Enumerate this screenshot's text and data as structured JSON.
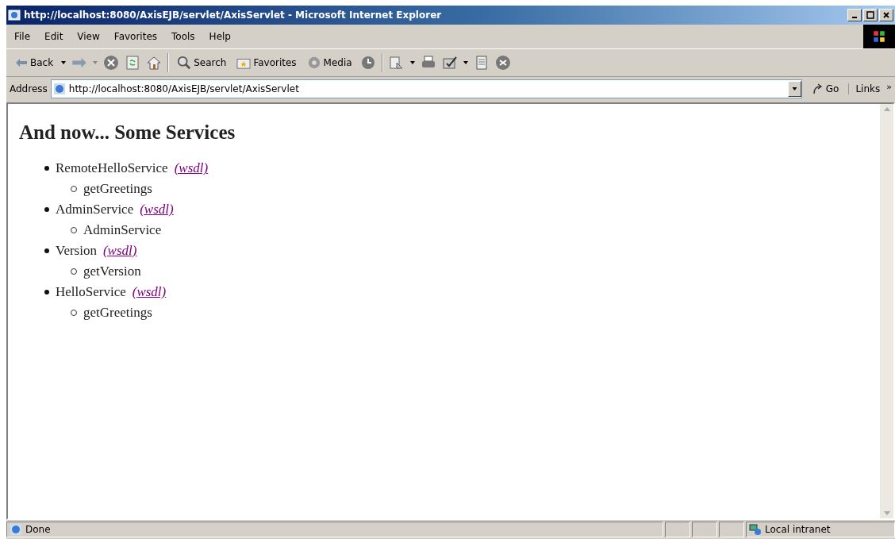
{
  "window": {
    "title": "http://localhost:8080/AxisEJB/servlet/AxisServlet - Microsoft Internet Explorer"
  },
  "menu": [
    "File",
    "Edit",
    "View",
    "Favorites",
    "Tools",
    "Help"
  ],
  "toolbar": {
    "back": "Back",
    "search": "Search",
    "favorites": "Favorites",
    "media": "Media"
  },
  "address_bar": {
    "label": "Address",
    "value": "http://localhost:8080/AxisEJB/servlet/AxisServlet",
    "go": "Go",
    "links": "Links",
    "more": "»"
  },
  "page": {
    "heading": "And now... Some Services",
    "services": [
      {
        "name": "RemoteHelloService",
        "link": "(wsdl)",
        "methods": [
          "getGreetings"
        ]
      },
      {
        "name": "AdminService",
        "link": "(wsdl)",
        "methods": [
          "AdminService"
        ]
      },
      {
        "name": "Version",
        "link": "(wsdl)",
        "methods": [
          "getVersion"
        ]
      },
      {
        "name": "HelloService",
        "link": "(wsdl)",
        "methods": [
          "getGreetings"
        ]
      }
    ]
  },
  "status_bar": {
    "status": "Done",
    "zone": "Local intranet"
  }
}
